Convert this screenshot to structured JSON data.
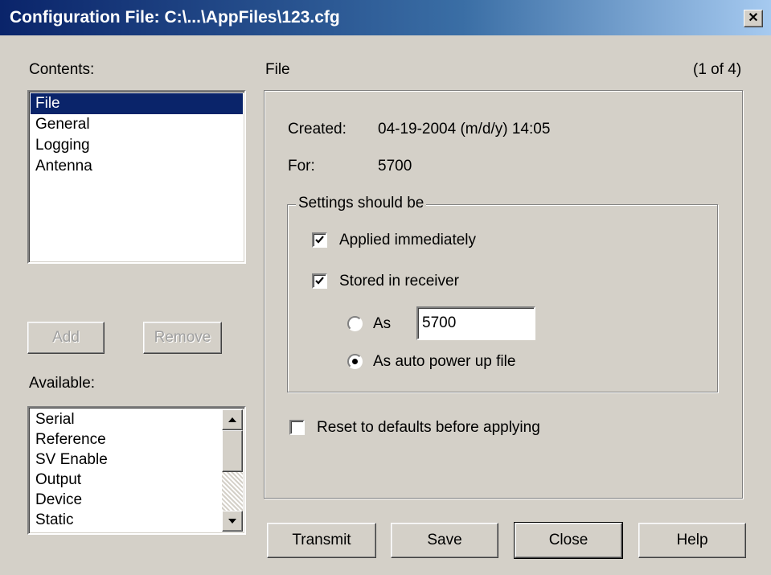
{
  "window": {
    "title": "Configuration File: C:\\...\\AppFiles\\123.cfg",
    "close_glyph": "✕"
  },
  "contents": {
    "label": "Contents:",
    "items": [
      "File",
      "General",
      "Logging",
      "Antenna"
    ],
    "selected_index": 0
  },
  "buttons": {
    "add": "Add",
    "remove": "Remove",
    "transmit": "Transmit",
    "save": "Save",
    "close": "Close",
    "help": "Help"
  },
  "available": {
    "label": "Available:",
    "items": [
      "Serial",
      "Reference",
      "SV Enable",
      "Output",
      "Device",
      "Static"
    ]
  },
  "section": {
    "title": "File",
    "page_indicator": "(1 of 4)"
  },
  "file_info": {
    "created_label": "Created:",
    "created_value": "04-19-2004 (m/d/y) 14:05",
    "for_label": "For:",
    "for_value": "5700"
  },
  "settings_group": {
    "legend": "Settings should be",
    "applied_label": "Applied immediately",
    "applied_checked": true,
    "stored_label": "Stored in receiver",
    "stored_checked": true,
    "as_label": "As",
    "as_value": "5700",
    "as_selected": false,
    "auto_label": "As auto power up file",
    "auto_selected": true
  },
  "reset": {
    "label": "Reset to defaults before applying",
    "checked": false
  }
}
